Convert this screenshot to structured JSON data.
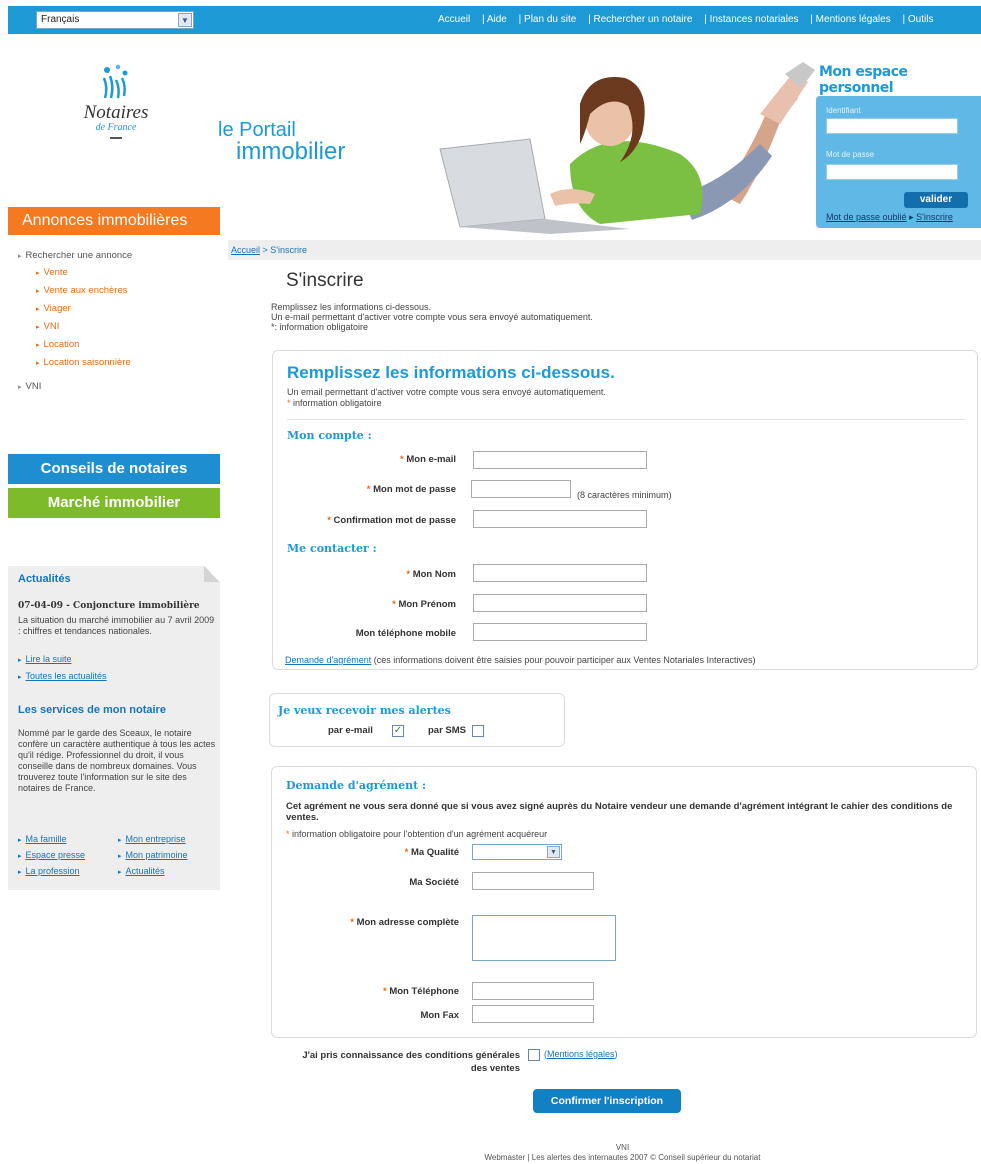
{
  "topbar": {
    "language": "Français",
    "nav": [
      "Accueil",
      "| Aide",
      "| Plan du site",
      "| Rechercher un notaire",
      "| Instances notariales",
      "| Mentions légales",
      "| Outils"
    ]
  },
  "logo": {
    "name": "Notaires",
    "sub": "de France"
  },
  "portal": {
    "line1": "le Portail",
    "line2": "immobilier"
  },
  "account": {
    "title": "Mon espace personnel",
    "id_label": "Identifiant",
    "pw_label": "Mot de passe",
    "validate": "valider",
    "forgot": "Mot de passe oublié",
    "register": "S'inscrire"
  },
  "left": {
    "annonces": "Annonces immobilières",
    "search": "Rechercher une annonce",
    "sub_items": [
      "Vente",
      "Vente aux enchères",
      "Viager",
      "VNI",
      "Location",
      "Location saisonnière"
    ],
    "vni": "VNI",
    "conseils": "Conseils de notaires",
    "marche": "Marché immobilier"
  },
  "side": {
    "news_head": "Actualités",
    "news_title": "07-04-09 - Conjoncture immobilière",
    "news_text": "La situation du marché immobilier au 7 avril 2009 : chiffres et tendances nationales.",
    "read_more": "Lire la suite",
    "all_news": "Toutes les actualités",
    "services_head": "Les services de mon notaire",
    "services_text": "Nommé par le garde des Sceaux, le notaire confère un caractère authentique à tous les actes qu'il rédige. Professionnel du droit, il vous conseille dans de nombreux domaines. Vous trouverez toute l'information sur le site des notaires de France.",
    "links": [
      "Ma famille",
      "Mon entreprise",
      "Espace presse",
      "Mon patrimoine",
      "La profession",
      "Actualités"
    ]
  },
  "breadcrumb": {
    "home": "Accueil",
    "sep": " > ",
    "current": "S'inscrire"
  },
  "page": {
    "title": "S'inscrire",
    "intro1": "Remplissez les informations ci-dessous.",
    "intro2": "Un e-mail permettant d'activer votre compte vous sera envoyé automatiquement.",
    "intro3": "*: information obligatoire"
  },
  "form": {
    "heading": "Remplissez les informations ci-dessous.",
    "sub1": "Un email permettant d'activer votre compte vous sera envoyé automatiquement.",
    "sub2": "information obligatoire",
    "star": "*",
    "account_section": "Mon compte :",
    "email": "Mon e-mail",
    "password": "Mon mot de passe",
    "password_hint": "(8 caractères minimum)",
    "confirm": "Confirmation mot de passe",
    "contact_section": "Me contacter :",
    "lastname": "Mon Nom",
    "firstname": "Mon Prénom",
    "mobile": "Mon téléphone mobile",
    "agrement_link": "Demande d'agrément",
    "agrement_note": " (ces informations doivent être saisies pour pouvoir participer aux Ventes Notariales Interactives)"
  },
  "alerts": {
    "heading": "Je veux recevoir mes alertes",
    "email": "par e-mail",
    "sms": "par SMS",
    "email_checked": true,
    "sms_checked": false
  },
  "agrement": {
    "heading": "Demande d'agrément :",
    "desc": "Cet agrément ne vous sera donné que si vous avez signé auprès du Notaire vendeur une demande d'agrément intégrant le cahier des conditions de ventes.",
    "note": "information obligatoire pour l'obtention d'un agrément acquéreur",
    "quality": "Ma Qualité",
    "company": "Ma Société",
    "address": "Mon adresse complète",
    "phone": "Mon Téléphone",
    "fax": "Mon Fax"
  },
  "terms": {
    "text": "J'ai pris connaissance des conditions générales des ventes",
    "link": "Mentions légales",
    "open": "(",
    "close": ")"
  },
  "confirm": "Confirmer l'inscription",
  "footer": {
    "line1": "VNI",
    "line2": "Webmaster  |  Les alertes des internautes   2007 © Conseil supérieur du notariat"
  },
  "colors": {
    "brand_blue": "#1d9ad6",
    "orange": "#f47920",
    "green": "#7dbb2a"
  }
}
